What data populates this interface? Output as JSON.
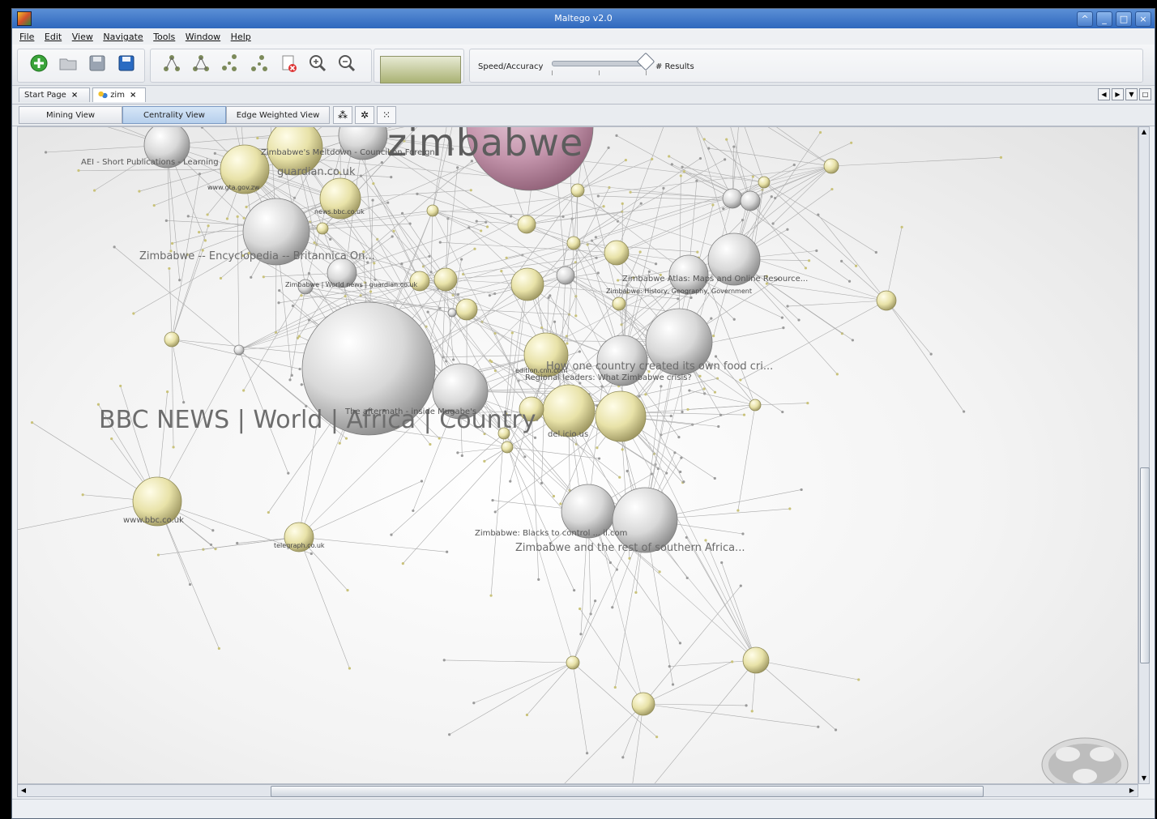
{
  "window": {
    "title": "Maltego v2.0"
  },
  "menu": [
    "File",
    "Edit",
    "View",
    "Navigate",
    "Tools",
    "Window",
    "Help"
  ],
  "toolbar": {
    "speed_label": "Speed/Accuracy",
    "results_label": "# Results",
    "speed_value_percent": 90
  },
  "tabs": [
    {
      "label": "Start Page"
    },
    {
      "label": "zim"
    }
  ],
  "views": [
    {
      "label": "Mining View"
    },
    {
      "label": "Centrality View"
    },
    {
      "label": "Edge Weighted View"
    }
  ],
  "active_view": "Centrality View",
  "graph": {
    "labels": {
      "zimbabwe": "zimbabwe",
      "bbc_news": "BBC NEWS | World | Africa | Country",
      "britannica": "Zimbabwe -- Encyclopedia -- Britannica On...",
      "food_crisis": "How one country created its own food cri...",
      "regional_leaders": "Regional leaders: What Zimbabwe crisis?",
      "atlas": "Zimbabwe Atlas: Maps and Online Resource...",
      "history": "Zimbabwe: History, Geography, Government",
      "blacks": "Zimbabwe: Blacks to control ... il.com",
      "rest_south": "Zimbabwe and the rest of southern Africa...",
      "aei": "AEI - Short Publications - Learning",
      "cfr": "Zimbabwe's Meltdown - Council on Foreign",
      "guardian": "guardian.co.uk",
      "gov_zw": "www.gta.gov.zw",
      "bbc_co_uk": "www.bbc.co.uk",
      "inside_mugabe": "The aftermath - inside Mugabe's",
      "news_bbc": "news.bbc.co.uk",
      "telegraph": "telegraph.co.uk",
      "guardian_small": "Zimbabwe | World news | guardian.co.uk",
      "edition_cnn": "edition.cnn.com",
      "delicious": "del.icio.us"
    }
  }
}
